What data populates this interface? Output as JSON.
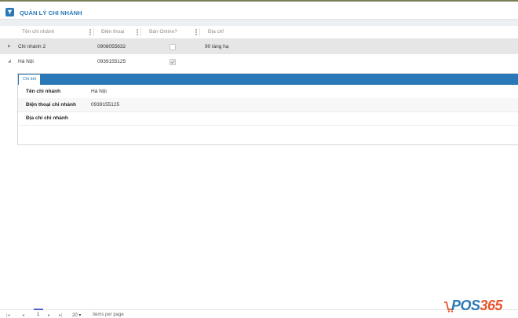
{
  "header": {
    "title": "QUẢN LÝ CHI NHÁNH",
    "filter_icon": "filter-icon"
  },
  "colors": {
    "accent": "#2a78b8",
    "row_selected": "#e6e6e6",
    "logo_orange": "#e8542c"
  },
  "grid": {
    "columns": [
      "Tên chi nhánh",
      "Điện thoại",
      "Bán Online?",
      "Địa chỉ"
    ],
    "rows": [
      {
        "name": "Chi nhánh 2",
        "phone": "0908055632",
        "online": false,
        "address": "90 láng hạ"
      },
      {
        "name": "Hà Nội",
        "phone": "0939155125",
        "online": true,
        "address": ""
      }
    ]
  },
  "detail": {
    "tab": "Chi tiết",
    "fields": [
      {
        "label": "Tên chi nhánh",
        "value": "Hà Nội"
      },
      {
        "label": "Điện thoại chi nhánh",
        "value": "0939155125"
      },
      {
        "label": "Địa chỉ chi nhánh",
        "value": ""
      }
    ]
  },
  "pager": {
    "first": "|◂",
    "prev": "◂",
    "current": "1",
    "next": "▸",
    "last": "▸|",
    "page_size": "20",
    "page_size_caret": "▾",
    "per_page_text": "items per page"
  },
  "logo": {
    "prefix": "POS",
    "number": "365"
  }
}
